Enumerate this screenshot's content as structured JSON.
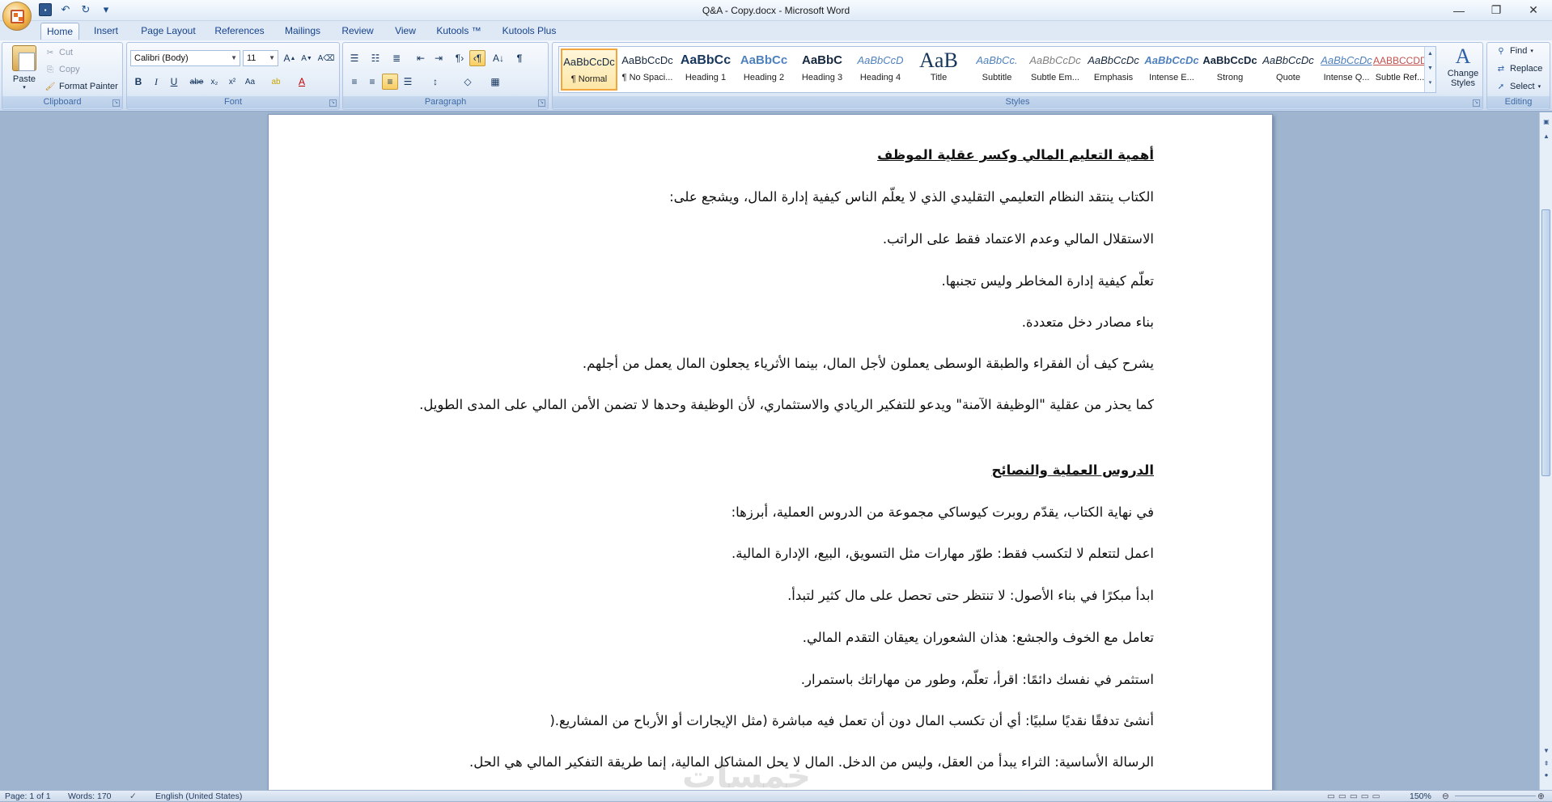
{
  "window": {
    "title": "Q&A - Copy.docx - Microsoft Word",
    "minimize": "—",
    "restore": "❐",
    "close": "✕"
  },
  "qat": {
    "save": "💾",
    "undo": "↶",
    "redo": "↻",
    "customize": "▾"
  },
  "tabs": [
    "Home",
    "Insert",
    "Page Layout",
    "References",
    "Mailings",
    "Review",
    "View",
    "Kutools ™",
    "Kutools Plus"
  ],
  "clipboard": {
    "paste": "Paste",
    "cut": "Cut",
    "copy": "Copy",
    "format_painter": "Format Painter",
    "label": "Clipboard"
  },
  "font": {
    "name": "Calibri (Body)",
    "size": "11",
    "label": "Font"
  },
  "paragraph": {
    "label": "Paragraph"
  },
  "styles": {
    "label": "Styles",
    "items": [
      {
        "preview": "AaBbCcDc",
        "name": "¶ Normal"
      },
      {
        "preview": "AaBbCcDc",
        "name": "¶ No Spaci..."
      },
      {
        "preview": "AaBbCc",
        "name": "Heading 1"
      },
      {
        "preview": "AaBbCc",
        "name": "Heading 2"
      },
      {
        "preview": "AaBbC",
        "name": "Heading 3"
      },
      {
        "preview": "AaBbCcD",
        "name": "Heading 4"
      },
      {
        "preview": "AaB",
        "name": "Title"
      },
      {
        "preview": "AaBbCc.",
        "name": "Subtitle"
      },
      {
        "preview": "AaBbCcDc",
        "name": "Subtle Em..."
      },
      {
        "preview": "AaBbCcDc",
        "name": "Emphasis"
      },
      {
        "preview": "AaBbCcDc",
        "name": "Intense E..."
      },
      {
        "preview": "AaBbCcDc",
        "name": "Strong"
      },
      {
        "preview": "AaBbCcDc",
        "name": "Quote"
      },
      {
        "preview": "AaBbCcDc",
        "name": "Intense Q..."
      },
      {
        "preview": "AABBCCDD",
        "name": "Subtle Ref..."
      }
    ],
    "change_styles": "Change Styles"
  },
  "editing": {
    "find": "Find",
    "replace": "Replace",
    "select": "Select",
    "label": "Editing"
  },
  "document": {
    "paragraphs": [
      {
        "text": "أهمية التعليم المالي وكسر عقلية الموظف",
        "heading": true
      },
      {
        "text": "الكتاب ينتقد النظام التعليمي التقليدي الذي لا يعلّم الناس كيفية إدارة المال، ويشجع على:"
      },
      {
        "text": "الاستقلال المالي وعدم الاعتماد فقط على الراتب."
      },
      {
        "text": "تعلّم كيفية إدارة المخاطر وليس تجنبها."
      },
      {
        "text": "بناء مصادر دخل متعددة."
      },
      {
        "text": "يشرح كيف أن الفقراء والطبقة الوسطى يعملون لأجل المال، بينما الأثرياء يجعلون المال يعمل من أجلهم."
      },
      {
        "text": "كما يحذر من عقلية \"الوظيفة الآمنة\" ويدعو للتفكير الريادي والاستثماري، لأن الوظيفة وحدها لا تضمن الأمن المالي على المدى الطويل.",
        "wrap": true
      },
      {
        "text": "الدروس العملية والنصائح",
        "heading": true
      },
      {
        "text": "في نهاية الكتاب، يقدّم روبرت كيوساكي مجموعة من الدروس العملية، أبرزها:"
      },
      {
        "text": "اعمل لتتعلم لا لتكسب فقط: طوّر مهارات مثل التسويق، البيع، الإدارة المالية."
      },
      {
        "text": "ابدأ مبكرًا في بناء الأصول: لا تنتظر حتى تحصل على مال كثير لتبدأ."
      },
      {
        "text": "تعامل مع الخوف والجشع: هذان الشعوران يعيقان التقدم المالي."
      },
      {
        "text": "استثمر في نفسك دائمًا: اقرأ، تعلّم، وطور من مهاراتك باستمرار."
      },
      {
        "text": "أنشئ تدفقًا نقديًا سلبيًا: أي أن تكسب المال دون أن تعمل فيه مباشرة (مثل الإيجارات أو الأرباح من المشاريع.("
      },
      {
        "text": "الرسالة الأساسية: الثراء يبدأ من العقل، وليس من الدخل. المال لا يحل المشاكل المالية، إنما طريقة التفكير المالي هي الحل."
      }
    ]
  },
  "status": {
    "page": "Page: 1 of 1",
    "words": "Words: 170",
    "language": "English (United States)",
    "zoom": "150%"
  },
  "watermark": "خمسات"
}
